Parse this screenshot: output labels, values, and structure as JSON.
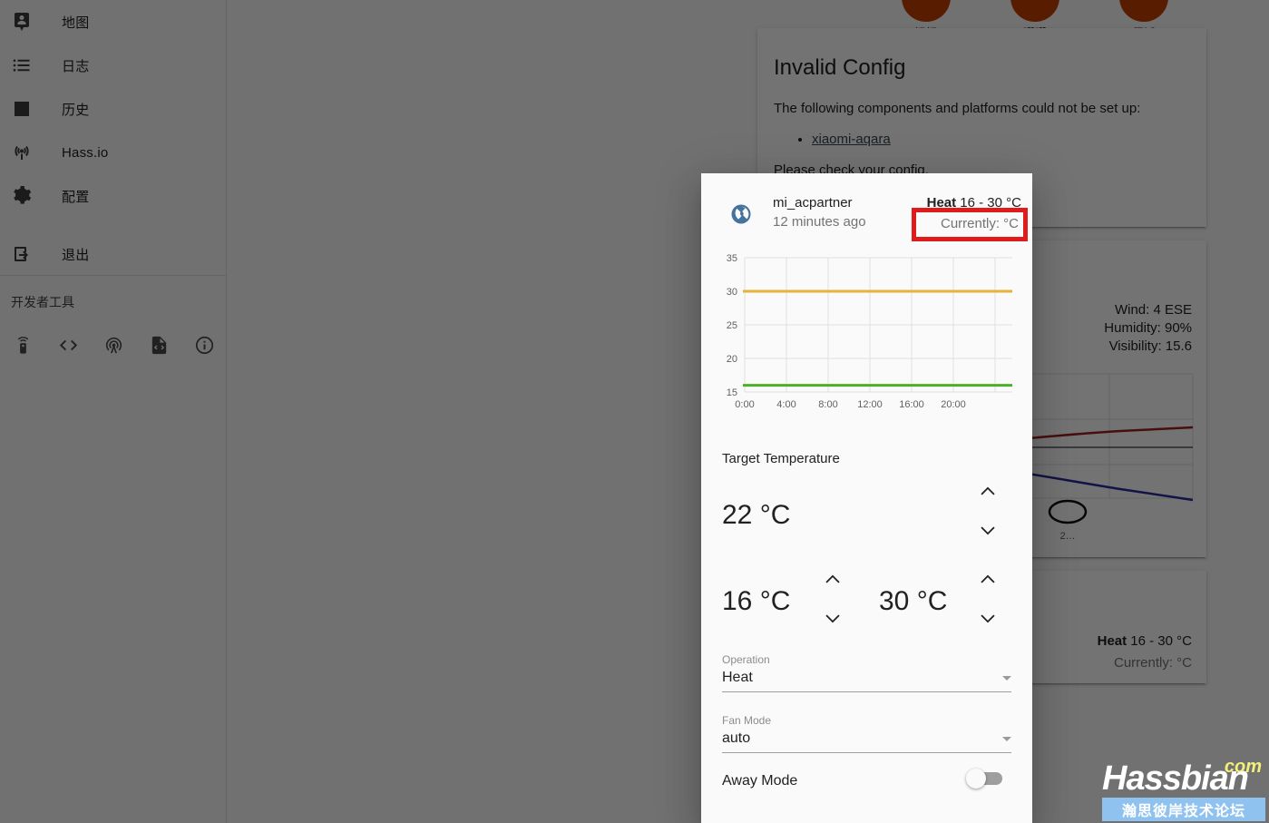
{
  "sidebar": {
    "items": [
      {
        "label": "地图",
        "icon": "account-badge-icon"
      },
      {
        "label": "日志",
        "icon": "format-list-bulleted-icon"
      },
      {
        "label": "历史",
        "icon": "chart-box-icon"
      },
      {
        "label": "Hass.io",
        "icon": "access-point-icon"
      },
      {
        "label": "配置",
        "icon": "gear-icon"
      },
      {
        "label": "退出",
        "icon": "logout-icon"
      }
    ],
    "devtools_title": "开发者工具",
    "devtools_icons": [
      "remote-icon",
      "code-tags-icon",
      "broadcast-icon",
      "file-code-icon",
      "information-icon"
    ]
  },
  "persons": [
    {
      "name": "妈妈"
    },
    {
      "name": "珊珊"
    },
    {
      "name": "程诚"
    }
  ],
  "invalid_config": {
    "title": "Invalid Config",
    "description": "The following components and platforms could not be set up:",
    "items": [
      "xiaomi-aqara"
    ],
    "footer": "Please check your config."
  },
  "weather_card": {
    "wind": "Wind: 4 ESE",
    "humidity": "Humidity: 90%",
    "visibility": "Visibility: 15.6"
  },
  "climate_card": {
    "mode": "Heat",
    "range": "16 - 30 °C",
    "current": "Currently: °C"
  },
  "dialog": {
    "icon": "thermostat-icon",
    "entity_name": "mi_acpartner",
    "last_changed": "12 minutes ago",
    "state_mode": "Heat",
    "state_range": "16 - 30 °C",
    "current": "Currently: °C",
    "highlight_color": "#e01b1b",
    "target_temperature_label": "Target Temperature",
    "target_value": "22 °C",
    "low_value": "16 °C",
    "high_value": "30 °C",
    "operation": {
      "label": "Operation",
      "value": "Heat"
    },
    "fan_mode": {
      "label": "Fan Mode",
      "value": "auto"
    },
    "away_mode": {
      "label": "Away Mode",
      "value": "off"
    }
  },
  "watermark": {
    "main": "Hassbian",
    "tld": "com",
    "sub": "瀚思彼岸技术论坛"
  },
  "chart_data": [
    {
      "type": "line",
      "title": "",
      "xlabel": "",
      "ylabel": "",
      "ylim": [
        15,
        35
      ],
      "yticks": [
        15,
        20,
        25,
        30,
        35
      ],
      "xticks": [
        "0:00",
        "4:00",
        "8:00",
        "12:00",
        "16:00",
        "20:00"
      ],
      "grid": true,
      "legend": "none",
      "series": [
        {
          "name": "target_temp_high",
          "color": "#e6b23a",
          "values": [
            30,
            30,
            30,
            30,
            30,
            30,
            30
          ]
        },
        {
          "name": "target_temp_low",
          "color": "#4caf28",
          "values": [
            16,
            16,
            16,
            16,
            16,
            16,
            16
          ]
        }
      ]
    },
    {
      "type": "line",
      "title": "",
      "xlabel": "",
      "ylabel": "",
      "grid": true,
      "legend": "none",
      "xticks": [
        "2…",
        "2…"
      ],
      "annotations": [
        "snow-cloud-icon",
        "cloud-icon",
        "cloud-icon",
        "cloud-icon"
      ],
      "series": [
        {
          "name": "temperature-high",
          "color": "#a02020",
          "values": [
            2.2,
            2.6,
            3.2,
            4.3,
            5.0,
            5.3
          ]
        },
        {
          "name": "temperature-low",
          "color": "#2a2aa0",
          "values": [
            1.1,
            1.5,
            1.6,
            1.0,
            0.1,
            -0.8
          ]
        },
        {
          "name": "zero-line",
          "color": "#000000",
          "values": [
            2.5,
            2.5,
            2.5,
            2.5,
            2.5,
            2.5
          ]
        }
      ]
    }
  ]
}
